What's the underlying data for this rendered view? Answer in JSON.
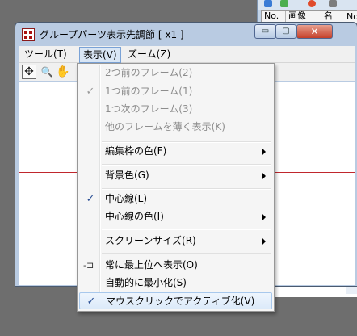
{
  "background_window": {
    "col_no": "No.",
    "col_image": "画像",
    "col_name": "名",
    "far_col": "No"
  },
  "window": {
    "title": "グループパーツ表示先調節 [ x1 ]",
    "minimize": "▭",
    "maximize": "▢",
    "close": "✕"
  },
  "menubar": {
    "tool": "ツール(T)",
    "view": "表示(V)",
    "zoom": "ズーム(Z)"
  },
  "toolbar": {
    "move": "✥",
    "zoom": "🔍",
    "hand": "✋"
  },
  "menu": {
    "items": [
      {
        "label": "2つ前のフレーム(2)",
        "disabled": true
      },
      {
        "label": "1つ前のフレーム(1)",
        "disabled": true,
        "check": "✓"
      },
      {
        "label": "1つ次のフレーム(3)",
        "disabled": true
      },
      {
        "label": "他のフレームを薄く表示(K)",
        "disabled": true
      },
      {
        "label": "編集枠の色(F)"
      },
      {
        "label": "背景色(G)"
      },
      {
        "label": "中心線(L)",
        "check": "✓"
      },
      {
        "label": "中心線の色(I)"
      },
      {
        "label": "スクリーンサイズ(R)"
      },
      {
        "label": "常に最上位へ表示(O)",
        "icon": "pin-icon"
      },
      {
        "label": "自動的に最小化(S)"
      },
      {
        "label": "マウスクリックでアクティブ化(V)",
        "check": "✓"
      }
    ]
  }
}
